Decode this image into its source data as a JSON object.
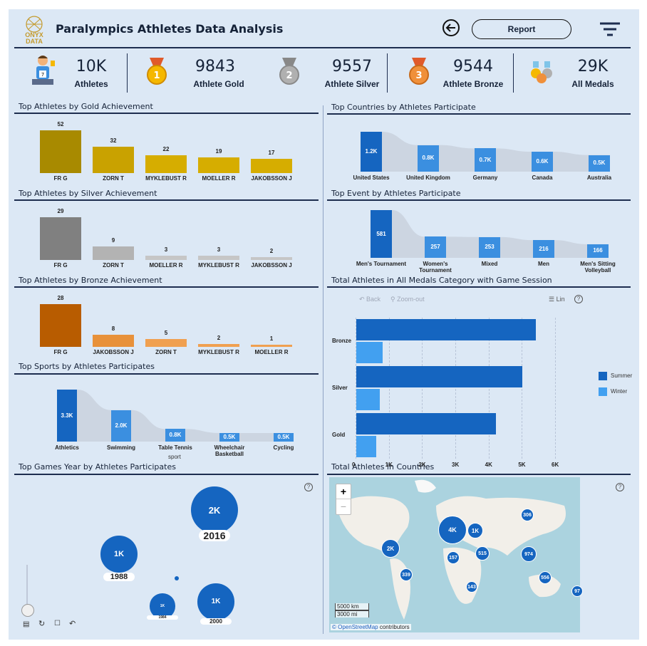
{
  "header": {
    "logo_text": "ONYX DATA",
    "title": "Paralympics Athletes Data Analysis",
    "report_button": "Report"
  },
  "kpis": [
    {
      "value": "10K",
      "label": "Athletes",
      "icon": "athlete-icon"
    },
    {
      "value": "9843",
      "label": "Athlete Gold",
      "icon": "gold-medal-icon"
    },
    {
      "value": "9557",
      "label": "Athlete Silver",
      "icon": "silver-medal-icon"
    },
    {
      "value": "9544",
      "label": "Athlete Bronze",
      "icon": "bronze-medal-icon"
    },
    {
      "value": "29K",
      "label": "All Medals",
      "icon": "medals-icon"
    }
  ],
  "sections": {
    "gold": "Top Athletes by Gold Achievement",
    "silver": "Top Athletes by Silver Achievement",
    "bronze": "Top Athletes by Bronze Achievement",
    "sports": "Top Sports by Athletes Participates",
    "years": "Top Games Year by Athletes Participates",
    "countries": "Top Countries by Athletes Participate",
    "events": "Top Event by Athletes Participate",
    "medals_session": "Total Athletes in All Medals Category with Game Session",
    "map": "Total Athletes in Countries"
  },
  "chart_data": [
    {
      "type": "bar",
      "title": "Top Athletes by Gold Achievement",
      "categories": [
        "FR G",
        "ZORN T",
        "MYKLEBUST R",
        "MOELLER R",
        "JAKOBSSON J"
      ],
      "values": [
        52,
        32,
        22,
        19,
        17
      ],
      "colors": [
        "#a88a00",
        "#c9a200",
        "#d6ad00",
        "#d6ad00",
        "#d6ad00"
      ]
    },
    {
      "type": "bar",
      "title": "Top Athletes by Silver Achievement",
      "categories": [
        "FR G",
        "ZORN T",
        "MOELLER R",
        "MYKLEBUST R",
        "JAKOBSSON J"
      ],
      "values": [
        29,
        9,
        3,
        3,
        2
      ],
      "colors": [
        "#808080",
        "#b3b3b3",
        "#c6c6c6",
        "#c6c6c6",
        "#c6c6c6"
      ]
    },
    {
      "type": "bar",
      "title": "Top Athletes by Bronze Achievement",
      "categories": [
        "FR G",
        "JAKOBSSON J",
        "ZORN T",
        "MYKLEBUST R",
        "MOELLER R"
      ],
      "values": [
        28,
        8,
        5,
        2,
        1
      ],
      "colors": [
        "#b85c00",
        "#e8913a",
        "#f0a050",
        "#f0a050",
        "#f0a050"
      ]
    },
    {
      "type": "bar",
      "title": "Top Sports by Athletes Participates",
      "categories": [
        "Athletics",
        "Swimming",
        "Table Tennis",
        "Wheelchair Basketball",
        "Cycling"
      ],
      "values": [
        3300,
        2000,
        800,
        500,
        500
      ],
      "value_labels": [
        "3.3K",
        "2.0K",
        "0.8K",
        "0.5K",
        "0.5K"
      ],
      "xlabel": "sport"
    },
    {
      "type": "bar",
      "title": "Top Countries by Athletes Participate",
      "categories": [
        "United States",
        "United Kingdom",
        "Germany",
        "Canada",
        "Australia"
      ],
      "values": [
        1200,
        800,
        700,
        600,
        500
      ],
      "value_labels": [
        "1.2K",
        "0.8K",
        "0.7K",
        "0.6K",
        "0.5K"
      ]
    },
    {
      "type": "bar",
      "title": "Top Event by Athletes Participate",
      "categories": [
        "Men's Tournament",
        "Women's Tournament",
        "Mixed",
        "Men",
        "Men's Sitting Volleyball"
      ],
      "values": [
        581,
        257,
        253,
        216,
        166
      ],
      "value_labels": [
        "581",
        "257",
        "253",
        "216",
        "166"
      ]
    },
    {
      "type": "bar",
      "orientation": "horizontal",
      "title": "Total Athletes in All Medals Category with Game Session",
      "categories": [
        "Bronze",
        "Silver",
        "Gold"
      ],
      "series": [
        {
          "name": "Summer",
          "values": [
            5400,
            5000,
            4200
          ],
          "color": "#1565c0"
        },
        {
          "name": "Winter",
          "values": [
            800,
            700,
            600
          ],
          "color": "#42a0f0"
        }
      ],
      "xlim": [
        0,
        6000
      ],
      "xticks": [
        "0",
        "1K",
        "2K",
        "3K",
        "4K",
        "5K",
        "6K"
      ]
    },
    {
      "type": "scatter",
      "title": "Top Games Year by Athletes Participates",
      "points": [
        {
          "label": "2016",
          "value_label": "2K",
          "value": 2000
        },
        {
          "label": "1988",
          "value_label": "1K",
          "value": 1000
        },
        {
          "label": "2000",
          "value_label": "1K",
          "value": 1000
        },
        {
          "label": "1984",
          "value_label": "1K",
          "value": 300
        }
      ]
    }
  ],
  "map": {
    "bubbles": [
      "4K",
      "1K",
      "2K",
      "306",
      "515",
      "974",
      "157",
      "339",
      "556",
      "143",
      "97"
    ],
    "scale_km": "5000 km",
    "scale_mi": "3000 mi",
    "attribution_link": "© OpenStreetMap",
    "attribution_rest": " contributors",
    "zoom_in": "+",
    "zoom_out": "−"
  },
  "medal_chart_controls": {
    "back": "Back",
    "zoom_out": "Zoom-out",
    "lin": "Lin"
  },
  "colors": {
    "accent": "#1565c0",
    "light": "#3b8fe0",
    "background": "#dce8f5",
    "navy": "#1d2d4f"
  }
}
